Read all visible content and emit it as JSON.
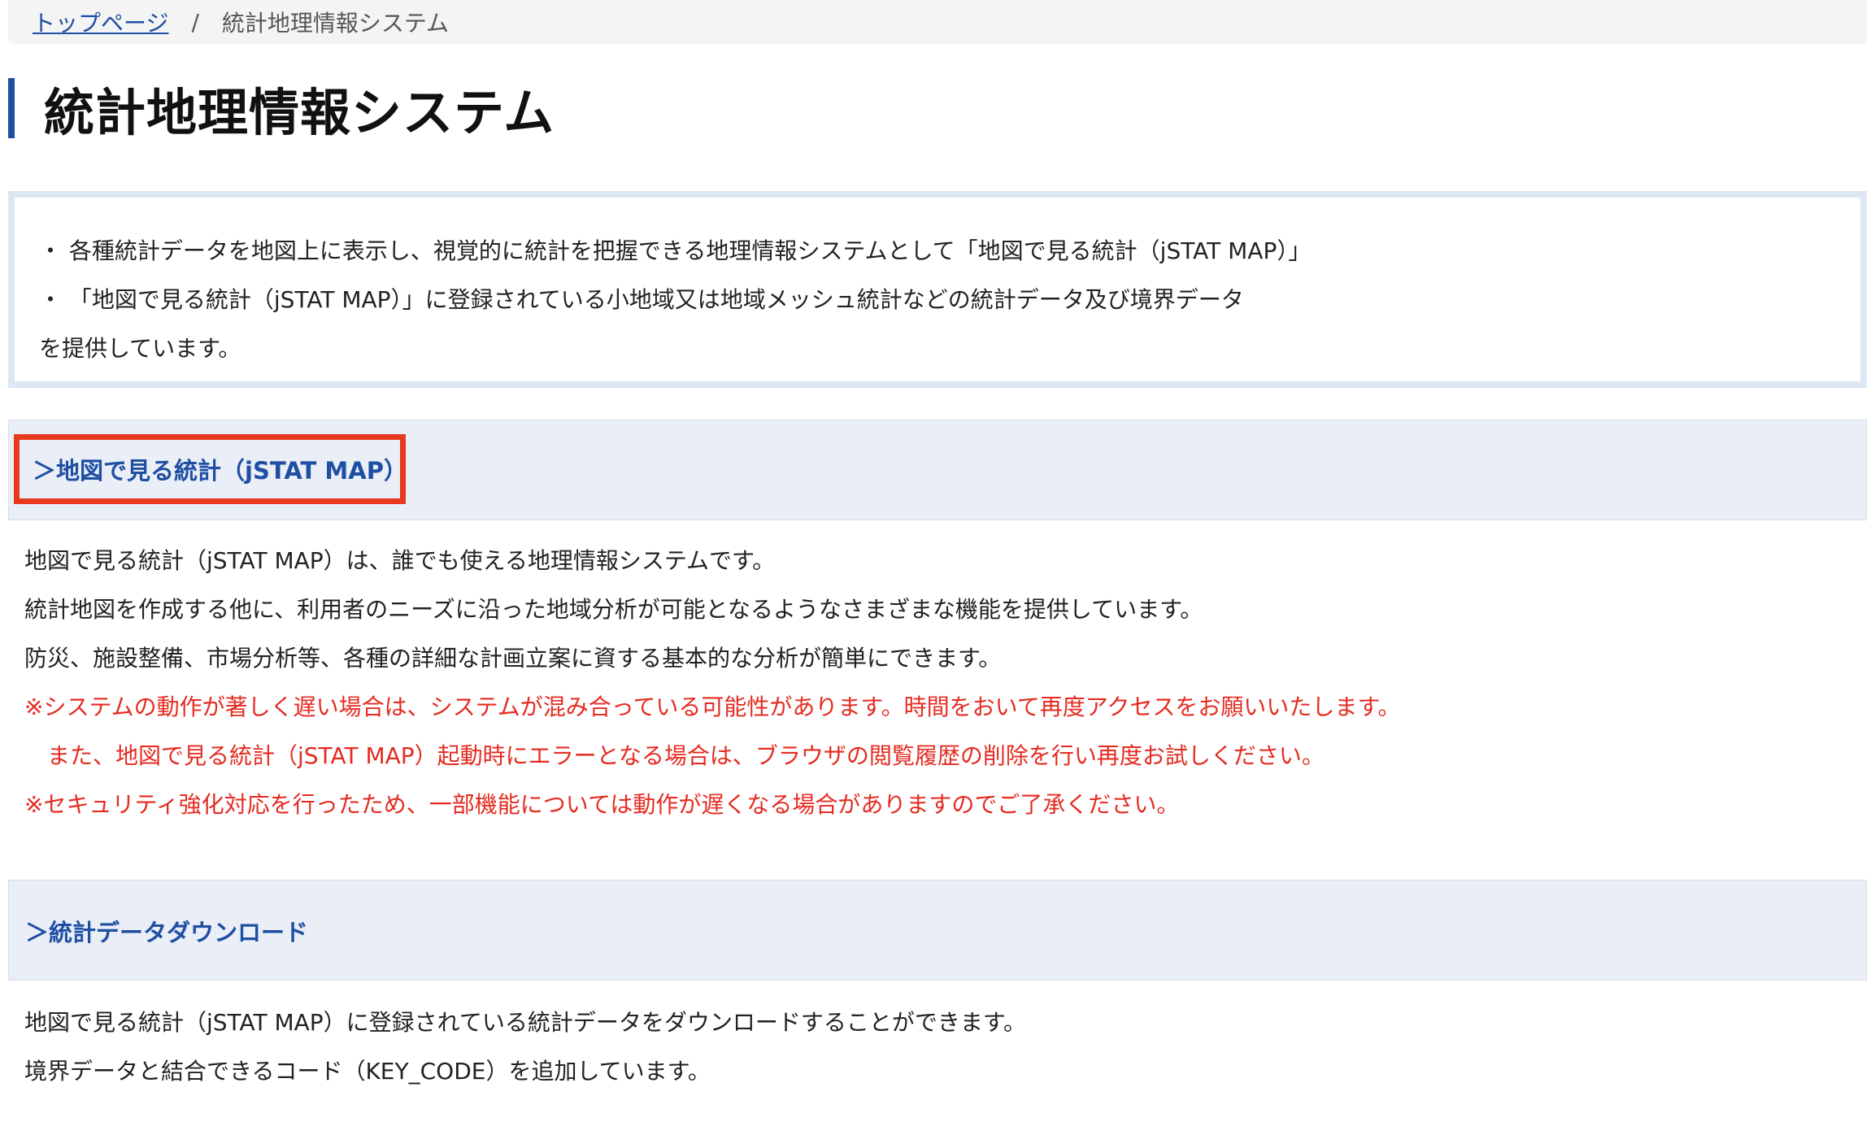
{
  "breadcrumb": {
    "home": "トップページ",
    "separator": "/",
    "current": "統計地理情報システム"
  },
  "page_title": "統計地理情報システム",
  "intro": {
    "lines": [
      "・ 各種統計データを地図上に表示し、視覚的に統計を把握できる地理情報システムとして「地図で見る統計（jSTAT MAP）」",
      "・ 「地図で見る統計（jSTAT MAP）」に登録されている小地域又は地域メッシュ統計などの統計データ及び境界データ",
      "を提供しています。"
    ]
  },
  "sections": [
    {
      "heading": "＞地図で見る統計（jSTAT MAP）",
      "paragraphs": [
        "地図で見る統計（jSTAT MAP）は、誰でも使える地理情報システムです。",
        "統計地図を作成する他に、利用者のニーズに沿った地域分析が可能となるようなさまざまな機能を提供しています。",
        "防災、施設整備、市場分析等、各種の詳細な計画立案に資する基本的な分析が簡単にできます。"
      ],
      "notices": [
        "※システムの動作が著しく遅い場合は、システムが混み合っている可能性があります。時間をおいて再度アクセスをお願いいたします。",
        "また、地図で見る統計（jSTAT MAP）起動時にエラーとなる場合は、ブラウザの閲覧履歴の削除を行い再度お試しください。",
        "※セキュリティ強化対応を行ったため、一部機能については動作が遅くなる場合がありますのでご了承ください。"
      ]
    },
    {
      "heading": "＞統計データダウンロード",
      "paragraphs": [
        "地図で見る統計（jSTAT MAP）に登録されている統計データをダウンロードすることができます。",
        "境界データと結合できるコード（KEY_CODE）を追加しています。"
      ]
    }
  ],
  "colors": {
    "link": "#1f4ea3",
    "notice": "#e52b21",
    "highlight_border": "#e8391f",
    "section_bg": "#e9eef7"
  }
}
